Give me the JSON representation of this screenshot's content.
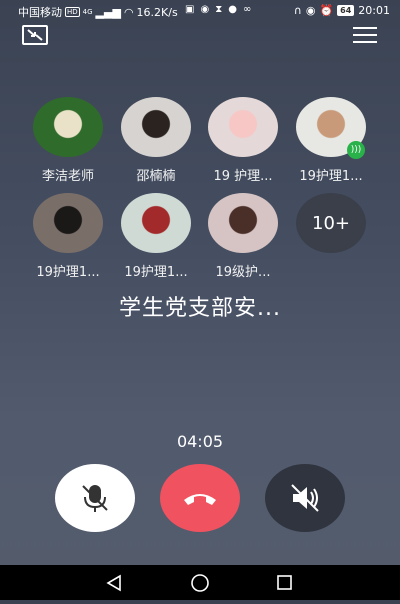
{
  "status_bar": {
    "carrier": "中国移动",
    "hd_badge": "HD",
    "network": "4G",
    "speed": "16.2K/s",
    "battery": "64",
    "time": "20:01"
  },
  "participants": [
    {
      "name": "李洁老师",
      "avatar_bg": "#2f6b2a",
      "avatar_accent": "#e9e2c8"
    },
    {
      "name": "邵楠楠",
      "avatar_bg": "#d7d3d0",
      "avatar_accent": "#2a2320"
    },
    {
      "name": "19 护理...",
      "avatar_bg": "#e5d8d8",
      "avatar_accent": "#f6c7c4"
    },
    {
      "name": "19护理1...",
      "avatar_bg": "#e7e7e3",
      "avatar_accent": "#c99a7a"
    },
    {
      "name": "19护理1...",
      "avatar_bg": "#7a6e69",
      "avatar_accent": "#1b1818"
    },
    {
      "name": "19护理1...",
      "avatar_bg": "#cfdad5",
      "avatar_accent": "#a32a2a"
    },
    {
      "name": "19级护...",
      "avatar_bg": "#d5c4c3",
      "avatar_accent": "#4a2e28"
    }
  ],
  "more_label": "10+",
  "group_title": "学生党支部安...",
  "call_timer": "04:05",
  "colors": {
    "hangup": "#f05260",
    "mute_btn": "#ffffff",
    "speaker_btn": "#30343e",
    "speaking_indicator": "#2ab24a"
  }
}
